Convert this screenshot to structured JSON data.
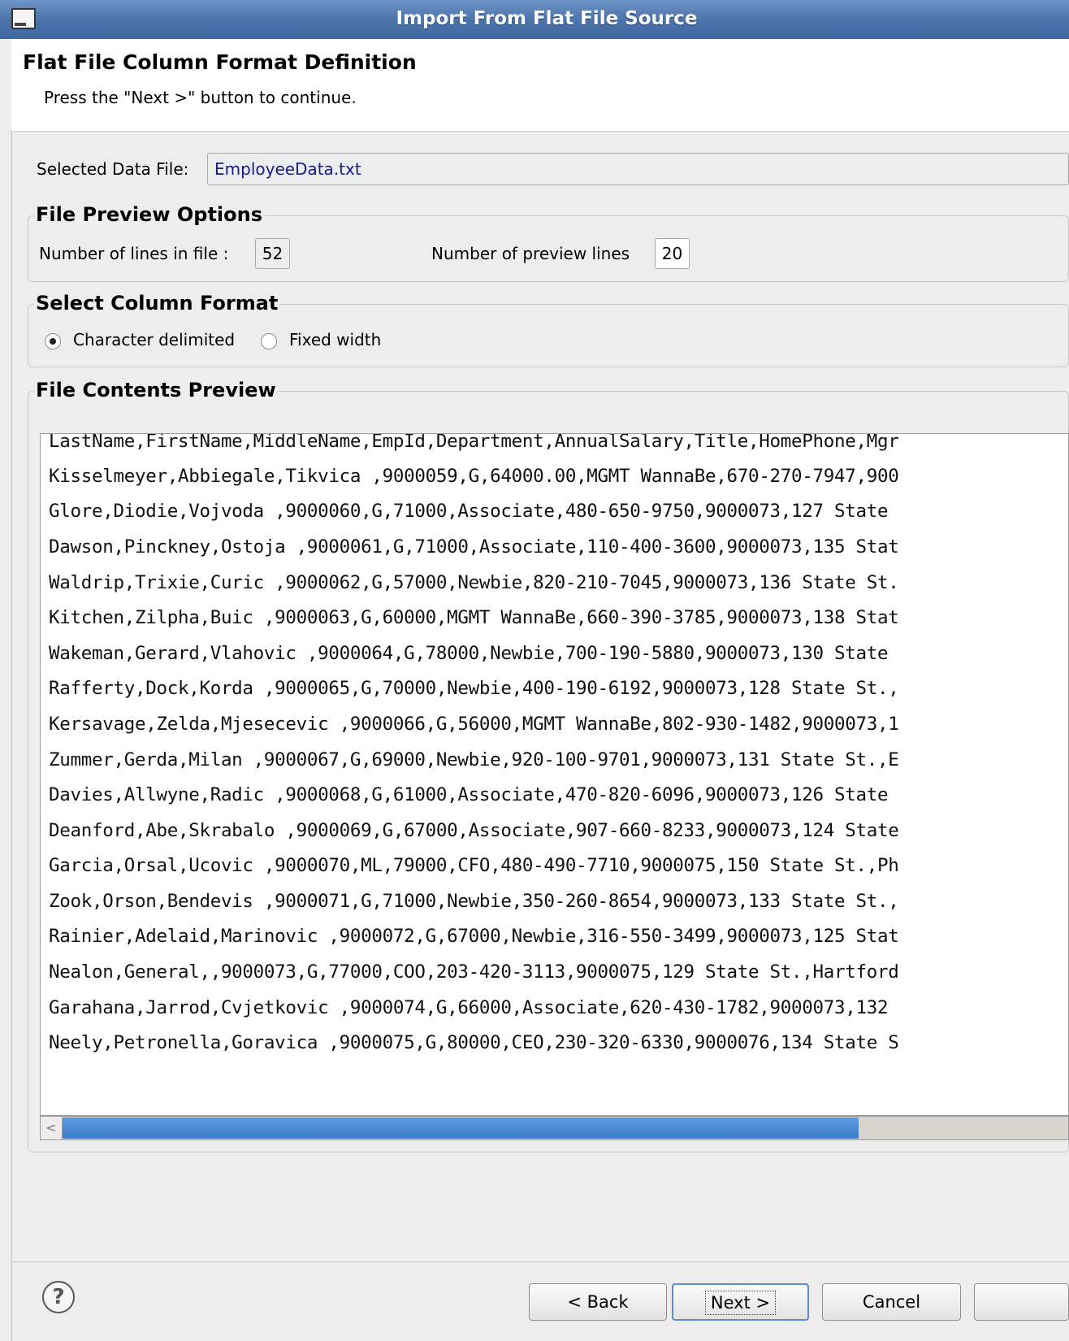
{
  "window": {
    "title": "Import From Flat File Source"
  },
  "header": {
    "title": "Flat File Column Format Definition",
    "subtitle": "Press the \"Next >\" button to continue."
  },
  "selected_file": {
    "label": "Selected Data File:",
    "value": "EmployeeData.txt"
  },
  "preview_options": {
    "title": "File Preview Options",
    "lines_in_file_label": "Number of lines in file :",
    "lines_in_file_value": "52",
    "preview_lines_label": "Number of preview lines",
    "preview_lines_value": "20"
  },
  "column_format": {
    "title": "Select Column Format",
    "options": [
      {
        "label": "Character delimited",
        "selected": true
      },
      {
        "label": "Fixed width",
        "selected": false
      }
    ]
  },
  "contents_preview": {
    "title": "File Contents Preview",
    "lines": [
      "LastName,FirstName,MiddleName,EmpId,Department,AnnualSalary,Title,HomePhone,Mgr",
      "Kisselmeyer,Abbiegale,Tikvica ,9000059,G,64000.00,MGMT WannaBe,670-270-7947,900",
      "Glore,Diodie,Vojvoda ,9000060,G,71000,Associate,480-650-9750,9000073,127 State",
      "Dawson,Pinckney,Ostoja ,9000061,G,71000,Associate,110-400-3600,9000073,135 Stat",
      "Waldrip,Trixie,Curic ,9000062,G,57000,Newbie,820-210-7045,9000073,136 State St.",
      "Kitchen,Zilpha,Buic ,9000063,G,60000,MGMT WannaBe,660-390-3785,9000073,138 Stat",
      "Wakeman,Gerard,Vlahovic ,9000064,G,78000,Newbie,700-190-5880,9000073,130 State",
      "Rafferty,Dock,Korda ,9000065,G,70000,Newbie,400-190-6192,9000073,128 State St.,",
      "Kersavage,Zelda,Mjesecevic ,9000066,G,56000,MGMT WannaBe,802-930-1482,9000073,1",
      "Zummer,Gerda,Milan ,9000067,G,69000,Newbie,920-100-9701,9000073,131 State St.,E",
      "Davies,Allwyne,Radic ,9000068,G,61000,Associate,470-820-6096,9000073,126 State",
      "Deanford,Abe,Skrabalo ,9000069,G,67000,Associate,907-660-8233,9000073,124 State",
      "Garcia,Orsal,Ucovic ,9000070,ML,79000,CFO,480-490-7710,9000075,150 State St.,Ph",
      "Zook,Orson,Bendevis ,9000071,G,71000,Newbie,350-260-8654,9000073,133 State St.,",
      "Rainier,Adelaid,Marinovic ,9000072,G,67000,Newbie,316-550-3499,9000073,125 Stat",
      "Nealon,General,,9000073,G,77000,COO,203-420-3113,9000075,129 State St.,Hartford",
      "Garahana,Jarrod,Cvjetkovic ,9000074,G,66000,Associate,620-430-1782,9000073,132",
      "Neely,Petronella,Goravica ,9000075,G,80000,CEO,230-320-6330,9000076,134 State S"
    ],
    "scroll_arrow": "<"
  },
  "buttons": {
    "help": "?",
    "back": "< Back",
    "next": "Next >",
    "cancel": "Cancel",
    "finish": ""
  }
}
